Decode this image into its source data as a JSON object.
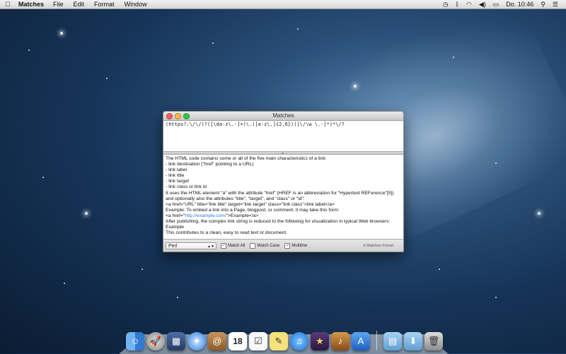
{
  "menubar": {
    "app_name": "Matches",
    "menus": [
      "File",
      "Edit",
      "Format",
      "Window"
    ],
    "clock": "Do. 10:46"
  },
  "window": {
    "title": "Matches",
    "pattern": "(https?:\\/\\/)?([\\da-z\\.-]+)\\.([a-z\\.]{2,6})([\\/\\w \\.-]*)*\\/?",
    "text_lines": [
      "The HTML code contains some or all of the five main characteristics of a link:",
      "- link destination (\"href\" pointing to a URL)",
      "- link label",
      "- link title",
      "- link target",
      "- link class or link id",
      "It uses the HTML element \"a\" with the attribute \"href\" (HREF is an abbreviation for \"Hypertext REFerence\"[5])",
      "and optionally also the attributes \"title\", \"target\", and \"class\" or \"id\":",
      "<a href=\"URL\" title=\"link title\" target=\"link target\" class=\"link class\">link label</a>",
      "Example: To embed a link into a Page, blogpost, or comment, it may take this form:",
      "EXAMPLE_LINE",
      "After publishing, the complex link string is reduced to the following for visualization in typical Web browsers:",
      "Example",
      "This contributes to a clean, easy to read text or document."
    ],
    "example_line_prefix": "<a href=\"",
    "example_line_link": "http://example.com/",
    "example_line_suffix": "\">Example</a>",
    "syntax": "Perl",
    "match_all_label": "Match All",
    "match_case_label": "Match Case",
    "multiline_label": "Multiline",
    "match_all_checked": true,
    "match_case_checked": false,
    "multiline_checked": true,
    "status": "5 Matches Found"
  },
  "dock": {
    "icons": [
      "finder-icon",
      "launchpad-icon",
      "mission-control-icon",
      "safari-icon",
      "contacts-icon",
      "calendar-icon",
      "reminders-icon",
      "notes-icon",
      "itunes-icon",
      "imovie-icon",
      "garageband-icon",
      "app-store-icon",
      "applications-folder-icon",
      "downloads-folder-icon",
      "trash-icon"
    ],
    "calendar_day": "18"
  }
}
